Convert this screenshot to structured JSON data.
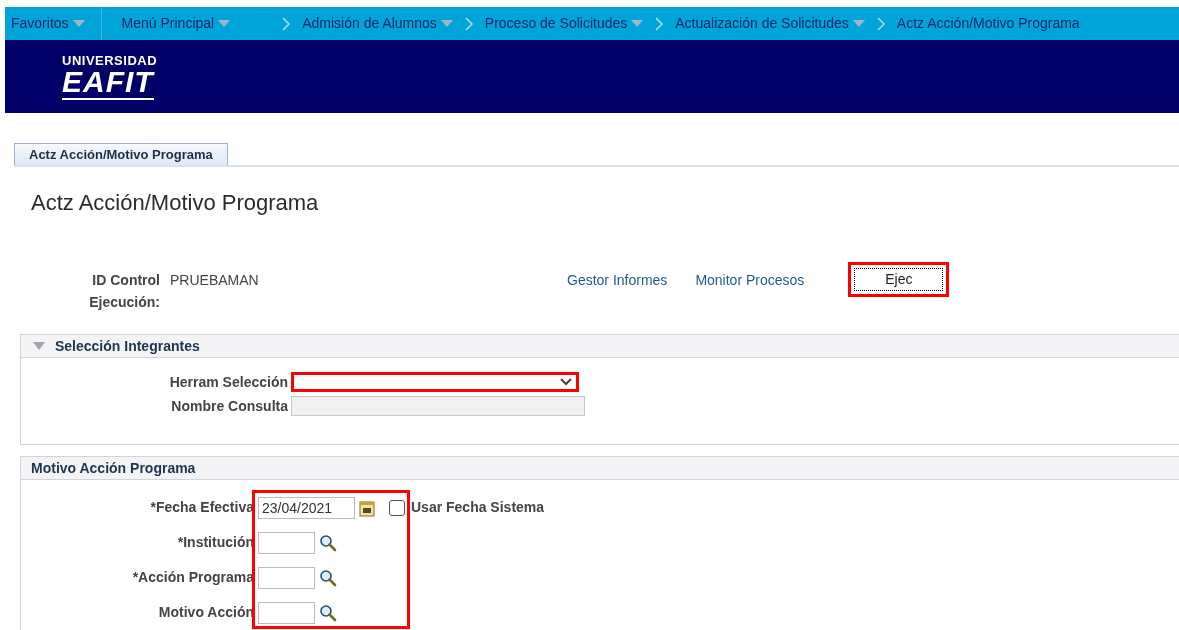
{
  "nav": [
    {
      "label": "Favoritos",
      "kind": "menu",
      "dropdown": true
    },
    {
      "label": "Menú Principal",
      "kind": "menu",
      "dropdown": true
    },
    {
      "label": "Admisión de Alumnos",
      "kind": "crumb",
      "dropdown": true
    },
    {
      "label": "Proceso de Solicitudes",
      "kind": "crumb",
      "dropdown": true
    },
    {
      "label": "Actualización de Solicitudes",
      "kind": "crumb",
      "dropdown": true
    },
    {
      "label": "Actz Acción/Motivo Programa",
      "kind": "crumb",
      "dropdown": false
    }
  ],
  "logo": {
    "line1": "UNIVERSIDAD",
    "line2": "EAFIT"
  },
  "tabs": [
    {
      "label": "Actz Acción/Motivo Programa",
      "selected": true
    }
  ],
  "page_title": "Actz Acción/Motivo Programa",
  "run_control": {
    "label_line1": "ID Control",
    "label_line2": "Ejecución:",
    "value": "PRUEBAMAN"
  },
  "links": [
    "Gestor Informes",
    "Monitor Procesos"
  ],
  "run_button": {
    "label": "Ejec",
    "highlighted": true
  },
  "section1": {
    "title": "Selección Integrantes",
    "expanded": true,
    "fields": [
      {
        "label": "Herram Selección",
        "kind": "select",
        "highlighted": true,
        "disabled": false
      },
      {
        "label": "Nombre Consulta",
        "kind": "text",
        "highlighted": false,
        "disabled": true
      }
    ]
  },
  "section2": {
    "title": "Motivo Acción Programa",
    "highlighted": true,
    "fields": [
      {
        "label": "*Fecha Efectiva",
        "kind": "date",
        "value": "23/04/2021"
      },
      {
        "label": "*Institución",
        "kind": "lookup"
      },
      {
        "label": "*Acción Programa",
        "kind": "lookup"
      },
      {
        "label": "Motivo Acción",
        "kind": "lookup"
      }
    ],
    "checkbox": {
      "label": "Usar Fecha Sistema",
      "checked": false
    }
  }
}
